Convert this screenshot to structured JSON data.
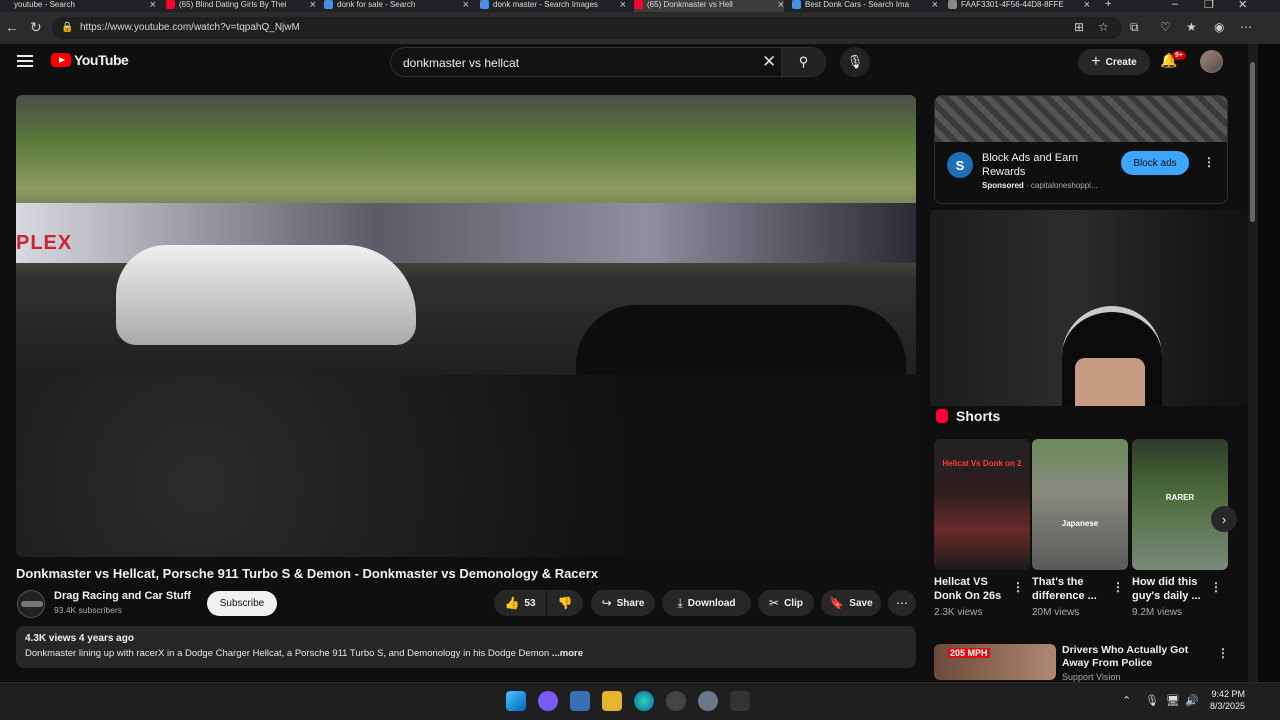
{
  "browser": {
    "tabs": [
      {
        "label": "youtube - Search",
        "color": "#4a90e2"
      },
      {
        "label": "(65) Blind Dating Girls By Thei",
        "color": "#ff0033"
      },
      {
        "label": "donk for sale - Search",
        "color": "#4a90e2"
      },
      {
        "label": "donk master - Search Images",
        "color": "#4a90e2"
      },
      {
        "label": "(65) Donkmaster vs Hell",
        "color": "#ff0033"
      },
      {
        "label": "Best Donk Cars - Search Ima",
        "color": "#4a90e2"
      },
      {
        "label": "FAAF3301-4F56-44D8-8FFE",
        "color": "#888888"
      }
    ],
    "new_tab": "+",
    "url": "https://www.youtube.com/watch?v=tqpahQ_NjwM"
  },
  "youtube": {
    "logo_text": "YouTube",
    "search_query": "donkmaster vs hellcat",
    "create_label": "Create",
    "notif_badge": "9+",
    "video": {
      "overlay_text": "PLEX",
      "title": "Donkmaster vs Hellcat, Porsche 911 Turbo S & Demon - Donkmaster vs Demonology & Racerx",
      "channel": "Drag Racing and Car Stuff",
      "subscribers": "93.4K subscribers",
      "subscribe_label": "Subscribe",
      "likes": "53",
      "share_label": "Share",
      "download_label": "Download",
      "clip_label": "Clip",
      "save_label": "Save",
      "views_date": "4.3K views  4 years ago",
      "description": "Donkmaster lining up with racerX in a Dodge Charger Hellcat, a Porsche 911 Turbo S, and Demonology in his Dodge Demon",
      "more_label": "...more"
    },
    "ad": {
      "title": "Block Ads and Earn Rewards",
      "sponsored": "Sponsored",
      "domain": "· capitaloneshoppi...",
      "cta": "Block ads",
      "logo_letter": "S"
    },
    "shorts": {
      "heading": "Shorts",
      "items": [
        {
          "title": "Hellcat VS Donk On 26s",
          "views": "2.3K views",
          "thumb_text": "Hellcat Vs Donk on 2"
        },
        {
          "title": "That's the difference ...",
          "views": "20M views",
          "thumb_text": "Japanese"
        },
        {
          "title": "How did this guy's daily ...",
          "views": "9.2M views",
          "thumb_text": "RARER"
        }
      ]
    },
    "recommended": {
      "title": "Drivers Who Actually Got Away From Police",
      "subtitle": "Support Vision",
      "thumb_text": "205 MPH"
    }
  },
  "taskbar": {
    "time": "9:42 PM",
    "date": "8/3/2025"
  }
}
